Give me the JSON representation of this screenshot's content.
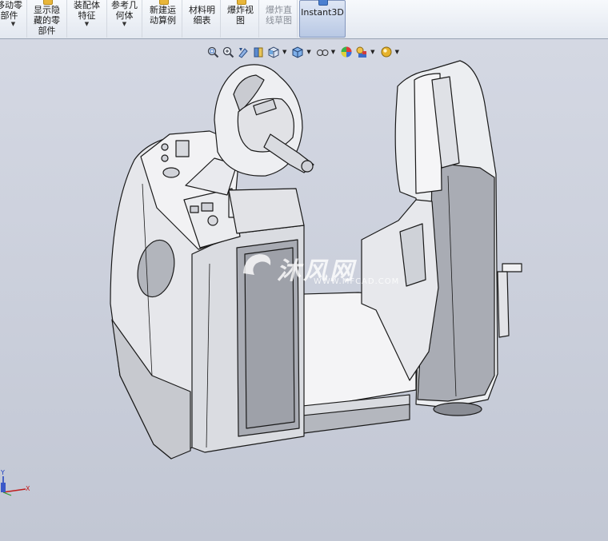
{
  "ribbon": {
    "buttons": [
      {
        "label": "移动零\n部件",
        "dropdown": true
      },
      {
        "label": "显示隐\n藏的零\n部件",
        "dropdown": false
      },
      {
        "label": "装配体\n特征",
        "dropdown": true
      },
      {
        "label": "参考几\n何体",
        "dropdown": true
      },
      {
        "label": "新建运\n动算例",
        "dropdown": false
      },
      {
        "label": "材料明\n细表",
        "dropdown": false
      },
      {
        "label": "爆炸视\n图",
        "dropdown": false
      },
      {
        "label": "爆炸直\n线草图",
        "dropdown": false
      },
      {
        "label": "Instant3D",
        "dropdown": false
      }
    ]
  },
  "view_toolbar": {
    "icons": [
      "zoom-to-fit-icon",
      "zoom-to-area-icon",
      "previous-view-icon",
      "section-view-icon",
      "view-orientation-icon",
      "display-style-icon",
      "hide-show-items-icon",
      "edit-appearance-icon",
      "apply-scene-icon",
      "view-settings-icon"
    ]
  },
  "watermark": {
    "brand": "沐风网",
    "url": "WWW.MFCAD.COM"
  },
  "triad": {
    "y_label": "Y",
    "x_label": "X"
  },
  "colors": {
    "viewport_top": "#d4d8e3",
    "viewport_bottom": "#c2c7d4",
    "model": "#f1f1f3",
    "edge": "#1a1a1a",
    "shade": "#9a9ca4"
  }
}
